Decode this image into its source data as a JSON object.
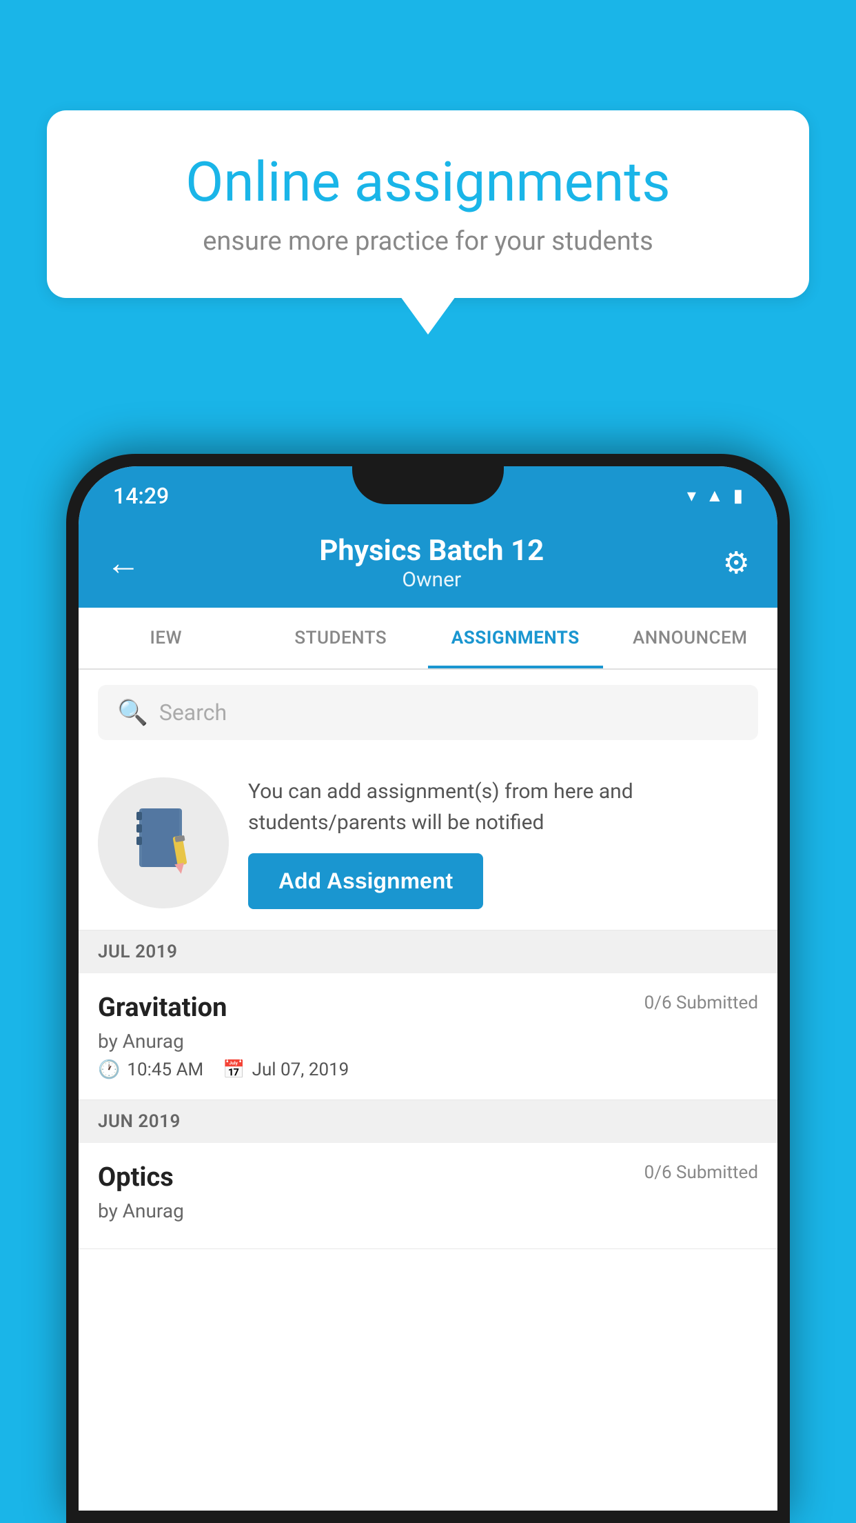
{
  "background": {
    "color": "#1ab5e8"
  },
  "speech_bubble": {
    "title": "Online assignments",
    "subtitle": "ensure more practice for your students"
  },
  "status_bar": {
    "time": "14:29",
    "icons": [
      "wifi",
      "signal",
      "battery"
    ]
  },
  "app_bar": {
    "title": "Physics Batch 12",
    "subtitle": "Owner",
    "back_label": "←",
    "settings_label": "⚙"
  },
  "tabs": [
    {
      "label": "IEW",
      "active": false
    },
    {
      "label": "STUDENTS",
      "active": false
    },
    {
      "label": "ASSIGNMENTS",
      "active": true
    },
    {
      "label": "ANNOUNCEM",
      "active": false
    }
  ],
  "search": {
    "placeholder": "Search"
  },
  "promo": {
    "text": "You can add assignment(s) from here and students/parents will be notified",
    "button_label": "Add Assignment"
  },
  "sections": [
    {
      "header": "JUL 2019",
      "items": [
        {
          "name": "Gravitation",
          "submitted": "0/6 Submitted",
          "by": "by Anurag",
          "time": "10:45 AM",
          "date": "Jul 07, 2019"
        }
      ]
    },
    {
      "header": "JUN 2019",
      "items": [
        {
          "name": "Optics",
          "submitted": "0/6 Submitted",
          "by": "by Anurag",
          "time": "",
          "date": ""
        }
      ]
    }
  ]
}
